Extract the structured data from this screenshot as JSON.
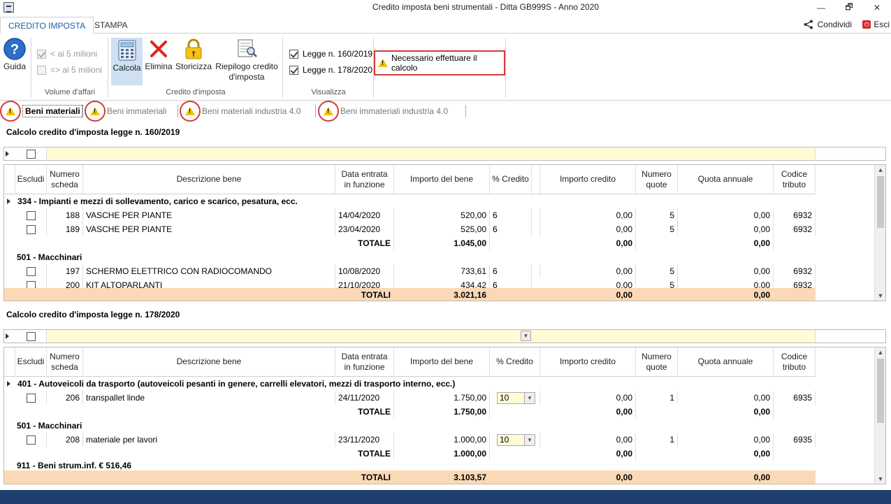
{
  "window": {
    "title": "Credito imposta beni strumentali - Ditta GB999S - Anno 2020",
    "minimize": "—",
    "restore": "🗗",
    "close": "✕"
  },
  "ribbon_tabs": {
    "active": "CREDITO IMPOSTA",
    "inactive": "STAMPA"
  },
  "share_label": "Condividi",
  "exit_label": "Esci",
  "ribbon": {
    "guida": "Guida",
    "volume": {
      "lt5": "< ai 5 milioni",
      "gte5": "=> ai 5 milioni",
      "group": "Volume d'affari"
    },
    "calcola": "Calcola",
    "elimina": "Elimina",
    "storicizza": "Storicizza",
    "riepilogo": "Riepilogo credito d'imposta",
    "credito_group": "Credito d'imposta",
    "legge1": "Legge n. 160/2019",
    "legge2": "Legge n. 178/2020",
    "visualizza_group": "Visualizza",
    "warning": "Necessario effettuare il calcolo"
  },
  "subtabs": [
    "Beni materiali",
    "Beni immateriali",
    "Beni materiali industria 4.0",
    "Beni immateriali industria 4.0"
  ],
  "headers": {
    "escludi": "Escludi",
    "numero_scheda": "Numero scheda",
    "descrizione": "Descrizione bene",
    "data": "Data entrata in funzione",
    "importo_bene": "Importo del bene",
    "perc": "% Credito",
    "importo_credito": "Importo credito",
    "numero_quote": "Numero quote",
    "quota": "Quota annuale",
    "codice": "Codice tributo"
  },
  "section1": {
    "title": "Calcolo credito d'imposta legge n. 160/2019",
    "group1": {
      "title": "334 - Impianti e mezzi di sollevamento, carico e scarico, pesatura, ecc.",
      "rows": [
        {
          "num": "188",
          "desc": "VASCHE PER PIANTE",
          "data": "14/04/2020",
          "importo": "520,00",
          "perc": "6",
          "credito": "0,00",
          "quote": "5",
          "quota": "0,00",
          "codice": "6932"
        },
        {
          "num": "189",
          "desc": "VASCHE PER PIANTE",
          "data": "23/04/2020",
          "importo": "525,00",
          "perc": "6",
          "credito": "0,00",
          "quote": "5",
          "quota": "0,00",
          "codice": "6932"
        }
      ],
      "total": {
        "label": "TOTALE",
        "importo": "1.045,00",
        "credito": "0,00",
        "quota": "0,00"
      }
    },
    "group2": {
      "title": "501 - Macchinari",
      "rows": [
        {
          "num": "197",
          "desc": "SCHERMO ELETTRICO CON RADIOCOMANDO",
          "data": "10/08/2020",
          "importo": "733,61",
          "perc": "6",
          "credito": "0,00",
          "quote": "5",
          "quota": "0,00",
          "codice": "6932"
        },
        {
          "num": "200",
          "desc": "KIT ALTOPARLANTI",
          "data": "21/10/2020",
          "importo": "434,42",
          "perc": "6",
          "credito": "0,00",
          "quote": "5",
          "quota": "0,00",
          "codice": "6932"
        }
      ]
    },
    "totals": {
      "label": "TOTALI",
      "importo": "3.021,16",
      "credito": "0,00",
      "quota": "0,00"
    }
  },
  "section2": {
    "title": "Calcolo credito d'imposta legge n. 178/2020",
    "group1": {
      "title": "401 - Autoveicoli da trasporto (autoveicoli pesanti in genere, carrelli elevatori, mezzi di trasporto interno, ecc.)",
      "rows": [
        {
          "num": "206",
          "desc": "transpallet linde",
          "data": "24/11/2020",
          "importo": "1.750,00",
          "perc": "10",
          "credito": "0,00",
          "quote": "1",
          "quota": "0,00",
          "codice": "6935"
        }
      ],
      "total": {
        "label": "TOTALE",
        "importo": "1.750,00",
        "credito": "0,00",
        "quota": "0,00"
      }
    },
    "group2": {
      "title": "501 - Macchinari",
      "rows": [
        {
          "num": "208",
          "desc": "materiale per lavori",
          "data": "23/11/2020",
          "importo": "1.000,00",
          "perc": "10",
          "credito": "0,00",
          "quote": "1",
          "quota": "0,00",
          "codice": "6935"
        }
      ],
      "total": {
        "label": "TOTALE",
        "importo": "1.000,00",
        "credito": "0,00",
        "quota": "0,00"
      }
    },
    "group3": {
      "title": "911 - Beni strum.inf. € 516,46"
    },
    "totals": {
      "label": "TOTALI",
      "importo": "3.103,57",
      "credito": "0,00",
      "quota": "0,00"
    }
  }
}
